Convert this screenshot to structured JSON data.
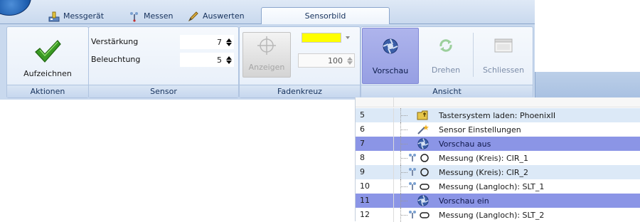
{
  "ribbon": {
    "tabs": [
      {
        "label": "Messgerät",
        "icon": "measuring-device-icon"
      },
      {
        "label": "Messen",
        "icon": "probe-icon"
      },
      {
        "label": "Auswerten",
        "icon": "evaluate-pen-icon"
      },
      {
        "label": "Sensorbild",
        "icon": "",
        "active": true
      }
    ],
    "groups": {
      "aktionen": {
        "label": "Aktionen",
        "record_label": "Aufzeichnen",
        "record_icon": "green-checkmark-icon"
      },
      "sensor": {
        "label": "Sensor",
        "gain_label": "Verstärkung",
        "gain_value": "7",
        "lighting_label": "Beleuchtung",
        "lighting_value": "5"
      },
      "fadenkreuz": {
        "label": "Fadenkreuz",
        "show_label": "Anzeigen",
        "show_icon": "crosshair-icon",
        "crosshair_color": "#ffff00",
        "size_value": "100"
      },
      "ansicht": {
        "label": "Ansicht",
        "preview_label": "Vorschau",
        "preview_icon": "aperture-icon",
        "rotate_label": "Drehen",
        "rotate_icon": "rotate-icon",
        "close_label": "Schliessen",
        "close_icon": "close-view-icon"
      }
    }
  },
  "program_list": {
    "rows": [
      {
        "num": "5",
        "text": "Tastersystem laden: PhoenixII",
        "icon": "folder-probe-icon",
        "style": "alt"
      },
      {
        "num": "6",
        "text": "Sensor Einstellungen",
        "icon": "wand-icon",
        "style": ""
      },
      {
        "num": "7",
        "text": "Vorschau aus",
        "icon": "aperture-icon",
        "style": "hl"
      },
      {
        "num": "8",
        "text": "Messung (Kreis): CIR_1",
        "icon": "circle-icon",
        "style": ""
      },
      {
        "num": "9",
        "text": "Messung (Kreis): CIR_2",
        "icon": "circle-icon",
        "style": "alt"
      },
      {
        "num": "10",
        "text": "Messung (Langloch): SLT_1",
        "icon": "slot-icon",
        "style": ""
      },
      {
        "num": "11",
        "text": "Vorschau ein",
        "icon": "aperture-icon",
        "style": "hl"
      },
      {
        "num": "12",
        "text": "Messung (Langloch): SLT_2",
        "icon": "slot-icon",
        "style": ""
      }
    ]
  },
  "colors": {
    "highlight_row": "#8b95e6",
    "alt_row": "#dce9f7",
    "active_button": "#aeb4ec"
  }
}
